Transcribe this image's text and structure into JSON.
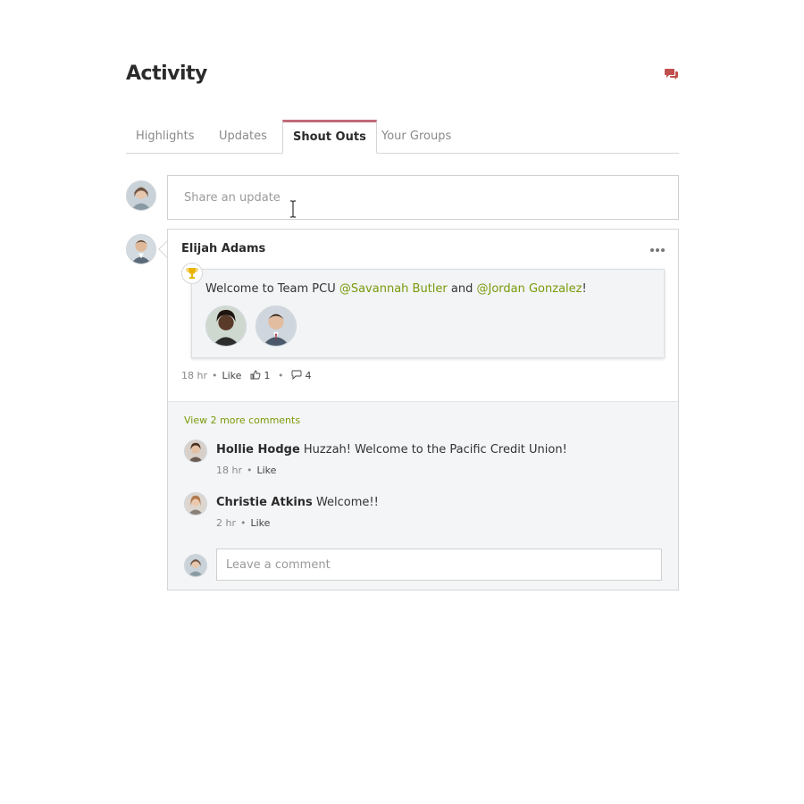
{
  "header": {
    "title": "Activity",
    "chat_icon": "chat-bubbles-icon"
  },
  "tabs": [
    {
      "label": "Highlights",
      "active": false
    },
    {
      "label": "Updates",
      "active": false
    },
    {
      "label": "Shout Outs",
      "active": true
    },
    {
      "label": "Your Groups",
      "active": false
    }
  ],
  "share": {
    "placeholder": "Share an update"
  },
  "post": {
    "author": "Elijah Adams",
    "shout": {
      "prefix": "Welcome to Team PCU ",
      "mention1": "@Savannah Butler",
      "middle": " and ",
      "mention2": "@Jordan Gonzalez",
      "suffix": "!"
    },
    "meta": {
      "time": "18 hr",
      "like_label": "Like",
      "like_count": "1",
      "comment_count": "4"
    }
  },
  "comments": {
    "view_more": "View 2 more comments",
    "items": [
      {
        "name": "Hollie Hodge",
        "text": "Huzzah! Welcome to the Pacific Credit Union!",
        "time": "18 hr",
        "like_label": "Like"
      },
      {
        "name": "Christie Atkins",
        "text": "Welcome!!",
        "time": "2 hr",
        "like_label": "Like"
      }
    ],
    "placeholder": "Leave a comment"
  },
  "colors": {
    "accent_tab": "#c06a79",
    "mention": "#7a9a0a",
    "chat_icon": "#c0504d",
    "trophy": "#e8b400"
  }
}
